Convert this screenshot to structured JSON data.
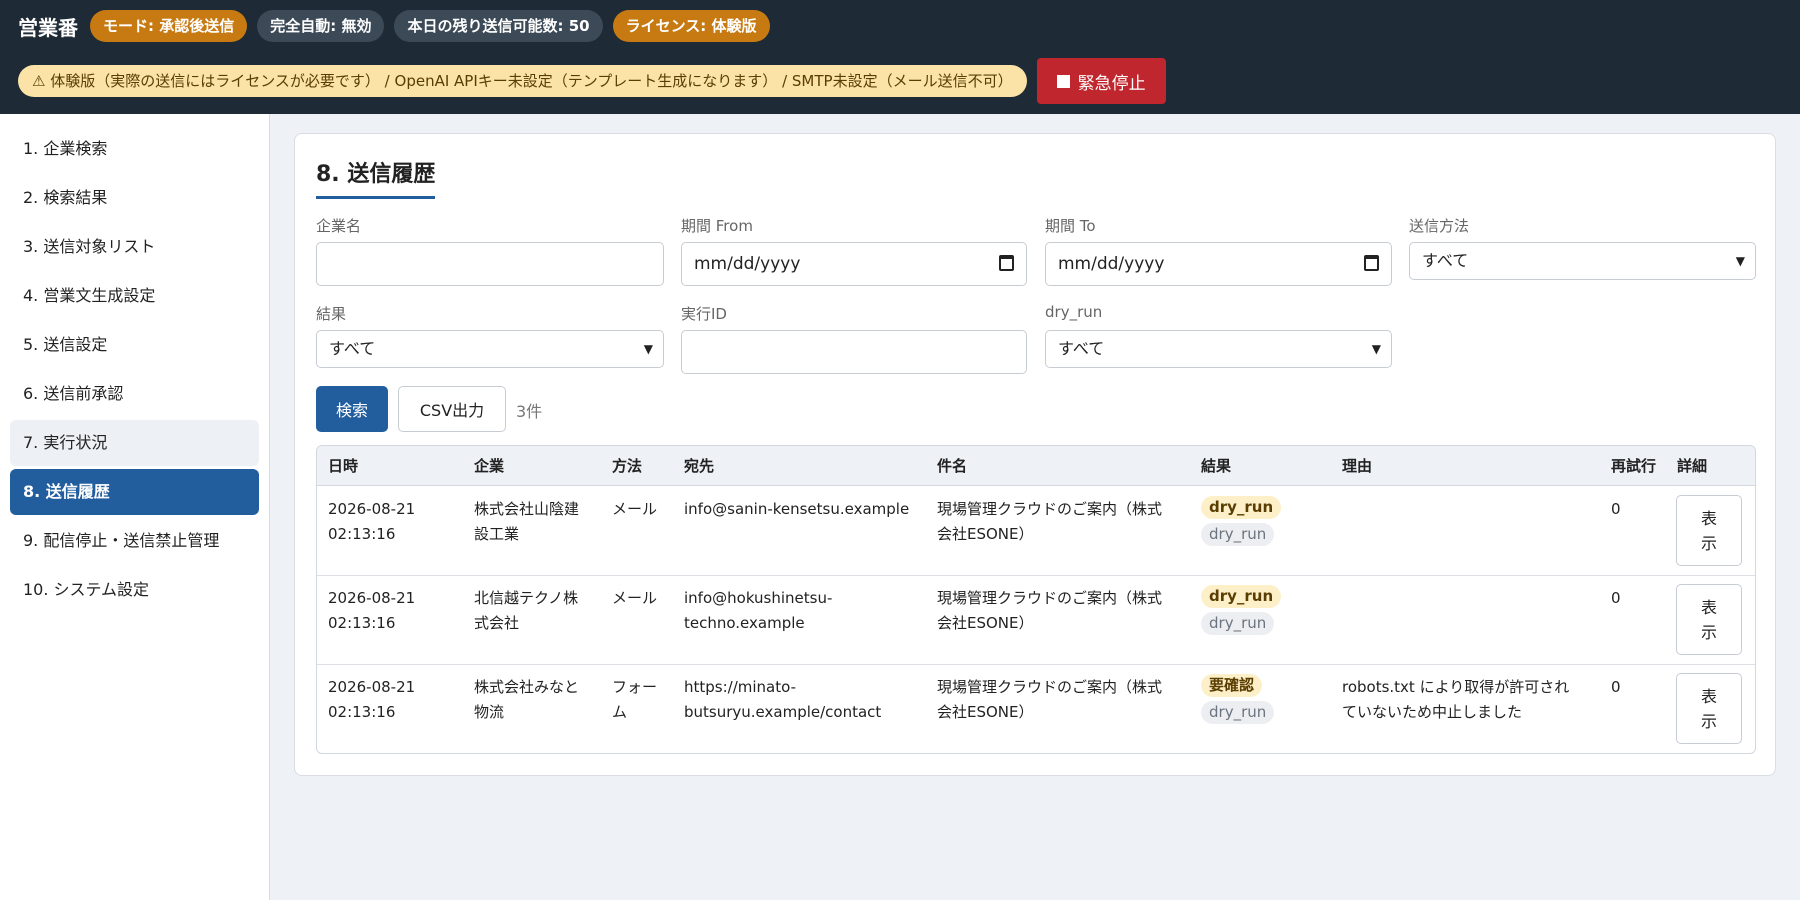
{
  "header": {
    "app_title": "営業番",
    "pills": {
      "mode": "モード: 承認後送信",
      "full_auto": "完全自動: 無効",
      "remaining": "本日の残り送信可能数: 50",
      "license": "ライセンス: 体験版"
    },
    "warning_text": "⚠ 体験版（実際の送信にはライセンスが必要です） / OpenAI APIキー未設定（テンプレート生成になります） / SMTP未設定（メール送信不可）",
    "stop_button": "緊急停止"
  },
  "sidebar": {
    "items": [
      {
        "label": "1. 企業検索"
      },
      {
        "label": "2. 検索結果"
      },
      {
        "label": "3. 送信対象リスト"
      },
      {
        "label": "4. 営業文生成設定"
      },
      {
        "label": "5. 送信設定"
      },
      {
        "label": "6. 送信前承認"
      },
      {
        "label": "7. 実行状況"
      },
      {
        "label": "8. 送信履歴"
      },
      {
        "label": "9. 配信停止・送信禁止管理"
      },
      {
        "label": "10. システム設定"
      }
    ],
    "active_index": 7
  },
  "main": {
    "title": "8. 送信履歴",
    "filters": {
      "company_label": "企業名",
      "company_value": "",
      "from_label": "期間 From",
      "from_placeholder": "mm/dd/yyyy",
      "to_label": "期間 To",
      "to_placeholder": "mm/dd/yyyy",
      "method_label": "送信方法",
      "method_value": "すべて",
      "result_label": "結果",
      "result_value": "すべて",
      "run_id_label": "実行ID",
      "run_id_value": "",
      "dry_run_label": "dry_run",
      "dry_run_value": "すべて"
    },
    "search_button": "検索",
    "csv_button": "CSV出力",
    "count_text": "3件",
    "table": {
      "headers": {
        "datetime": "日時",
        "company": "企業",
        "method": "方法",
        "to": "宛先",
        "subject": "件名",
        "result": "結果",
        "reason": "理由",
        "retry": "再試行",
        "detail": "詳細"
      },
      "rows": [
        {
          "date": "2026-08-21",
          "time": "02:13:16",
          "company_l1": "株式会社山陰建",
          "company_l2": "設工業",
          "method_l1": "メール",
          "method_l2": "",
          "to_l1": "info@sanin-kensetsu.example",
          "to_l2": "",
          "subject_l1": "現場管理クラウドのご案内（株式",
          "subject_l2": "会社ESONE）",
          "result_badge": "dry_run",
          "dry_badge": "dry_run",
          "reason_l1": "",
          "reason_l2": "",
          "retry": "0",
          "detail_l1": "表",
          "detail_l2": "示"
        },
        {
          "date": "2026-08-21",
          "time": "02:13:16",
          "company_l1": "北信越テクノ株",
          "company_l2": "式会社",
          "method_l1": "メール",
          "method_l2": "",
          "to_l1": "info@hokushinetsu-",
          "to_l2": "techno.example",
          "subject_l1": "現場管理クラウドのご案内（株式",
          "subject_l2": "会社ESONE）",
          "result_badge": "dry_run",
          "dry_badge": "dry_run",
          "reason_l1": "",
          "reason_l2": "",
          "retry": "0",
          "detail_l1": "表",
          "detail_l2": "示"
        },
        {
          "date": "2026-08-21",
          "time": "02:13:16",
          "company_l1": "株式会社みなと",
          "company_l2": "物流",
          "method_l1": "フォー",
          "method_l2": "ム",
          "to_l1": "https://minato-",
          "to_l2": "butsuryu.example/contact",
          "subject_l1": "現場管理クラウドのご案内（株式",
          "subject_l2": "会社ESONE）",
          "result_badge": "要確認",
          "dry_badge": "dry_run",
          "reason_l1": "robots.txt により取得が許可され",
          "reason_l2": "ていないため中止しました",
          "retry": "0",
          "detail_l1": "表",
          "detail_l2": "示"
        }
      ]
    }
  },
  "colors": {
    "header_bg": "#1e2a35",
    "accent": "#225e9e",
    "orange_pill": "#c77a12",
    "danger": "#c0262d",
    "warning_bg": "#fbe2a6"
  }
}
